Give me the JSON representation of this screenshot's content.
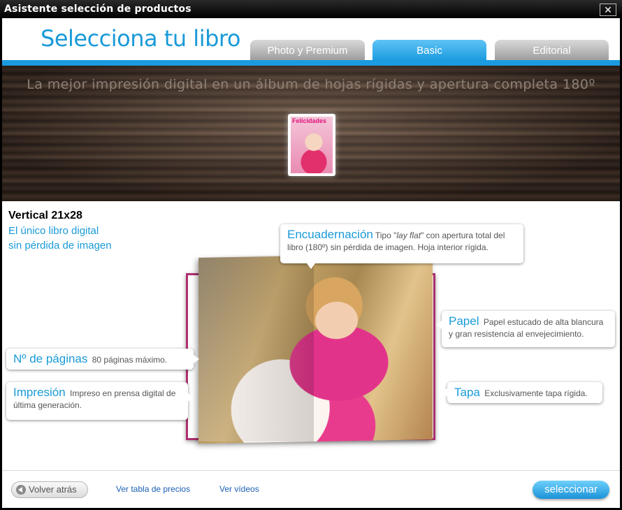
{
  "window": {
    "title": "Asistente selección de productos",
    "close_label": "✕"
  },
  "header": {
    "title": "Selecciona tu libro",
    "tabs": [
      {
        "label": "Photo y Premium",
        "active": false
      },
      {
        "label": "Basic",
        "active": true
      },
      {
        "label": "Editorial",
        "active": false
      }
    ]
  },
  "banner": {
    "tagline": "La mejor impresión digital en un álbum de hojas rígidas y apertura completa 180º",
    "thumbnail_cover_title": "Felicidades",
    "size_label": "21x28"
  },
  "product": {
    "name": "Vertical 21x28",
    "description_line1": "El único libro digital",
    "description_line2": "sin pérdida de imagen"
  },
  "callouts": {
    "encuadernacion": {
      "heading": "Encuadernación",
      "text_before": "Tipo \"",
      "text_italic": "lay flat",
      "text_after": "\" con apertura total del libro (180º) sin pérdida de imagen. Hoja interior rígida."
    },
    "papel": {
      "heading": "Papel",
      "text": "Papel estucado de alta blancura y gran resistencia al envejecimiento."
    },
    "paginas": {
      "heading": "Nº de páginas",
      "text": "80 páginas máximo."
    },
    "impresion": {
      "heading": "Impresión",
      "text": "Impreso en prensa digital de última generación."
    },
    "tapa": {
      "heading": "Tapa",
      "text": "Exclusivamente tapa rígida."
    }
  },
  "footer": {
    "back_label": "Volver atrás",
    "prices_link": "Ver tabla de precios",
    "videos_link": "Ver vídeos",
    "select_label": "seleccionar"
  },
  "colors": {
    "accent_blue": "#1a9ad8",
    "book_border": "#b03070"
  }
}
